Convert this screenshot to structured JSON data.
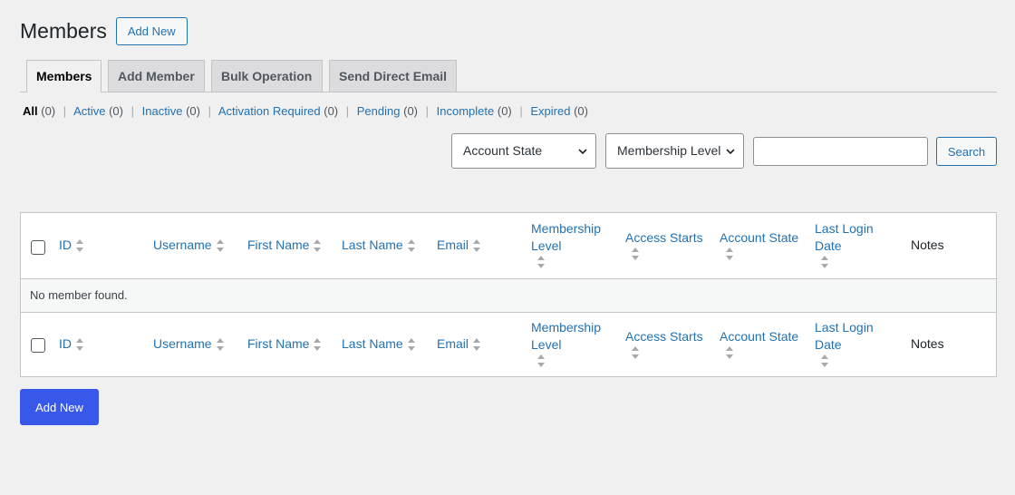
{
  "header": {
    "title": "Members",
    "add_new_label": "Add New"
  },
  "tabs": [
    {
      "label": "Members",
      "active": true
    },
    {
      "label": "Add Member"
    },
    {
      "label": "Bulk Operation"
    },
    {
      "label": "Send Direct Email"
    }
  ],
  "filters": [
    {
      "label": "All",
      "count": "(0)",
      "current": true
    },
    {
      "label": "Active",
      "count": "(0)"
    },
    {
      "label": "Inactive",
      "count": "(0)"
    },
    {
      "label": "Activation Required",
      "count": "(0)"
    },
    {
      "label": "Pending",
      "count": "(0)"
    },
    {
      "label": "Incomplete",
      "count": "(0)"
    },
    {
      "label": "Expired",
      "count": "(0)"
    }
  ],
  "search": {
    "account_state_selected": "Account State",
    "membership_level_selected": "Membership Level",
    "query": "",
    "button_label": "Search"
  },
  "table": {
    "columns": {
      "id": "ID",
      "username": "Username",
      "first_name": "First Name",
      "last_name": "Last Name",
      "email": "Email",
      "membership_level": "Membership Level",
      "access_starts": "Access Starts",
      "account_state": "Account State",
      "last_login_date": "Last Login Date",
      "notes": "Notes"
    },
    "empty_message": "No member found."
  },
  "footer": {
    "add_new_label": "Add New"
  },
  "colors": {
    "link": "#2271b1",
    "primary": "#3858e9",
    "background": "#f0f0f1",
    "border": "#c3c4c7"
  }
}
